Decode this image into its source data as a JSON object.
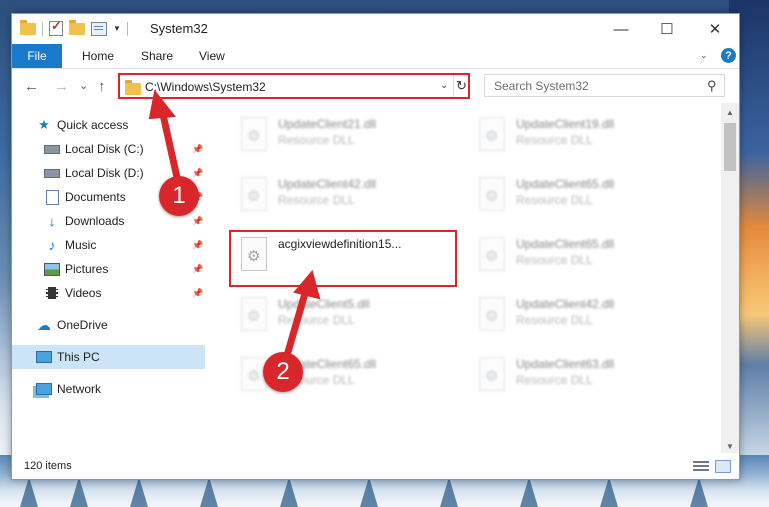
{
  "window": {
    "title": "System32"
  },
  "titlebar_controls": {
    "minimize": "—",
    "maximize": "☐",
    "close": "✕"
  },
  "ribbon": {
    "tabs": [
      "File",
      "Home",
      "Share",
      "View"
    ],
    "help_label": "?"
  },
  "navigation": {
    "back": "←",
    "forward": "→",
    "recent": "⌄",
    "up": "↑",
    "address_path": "C:\\Windows\\System32",
    "refresh": "↻"
  },
  "search": {
    "placeholder": "Search System32"
  },
  "sidebar": {
    "items": [
      {
        "label": "Quick access",
        "icon": "star-icon",
        "pinned": false
      },
      {
        "label": "Local Disk (C:)",
        "icon": "drive-icon",
        "pinned": true
      },
      {
        "label": "Local Disk (D:)",
        "icon": "drive-icon",
        "pinned": true
      },
      {
        "label": "Documents",
        "icon": "documents-icon",
        "pinned": true
      },
      {
        "label": "Downloads",
        "icon": "download-icon",
        "pinned": true
      },
      {
        "label": "Music",
        "icon": "music-icon",
        "pinned": true
      },
      {
        "label": "Pictures",
        "icon": "pictures-icon",
        "pinned": true
      },
      {
        "label": "Videos",
        "icon": "videos-icon",
        "pinned": true
      },
      {
        "label": "OneDrive",
        "icon": "cloud-icon",
        "pinned": false
      },
      {
        "label": "This PC",
        "icon": "computer-icon",
        "pinned": false,
        "selected": true
      },
      {
        "label": "Network",
        "icon": "network-icon",
        "pinned": false
      }
    ]
  },
  "files": [
    {
      "name": "UpdateClient21.dll",
      "type": "Resource DLL",
      "blurred": true
    },
    {
      "name": "UpdateClient19.dll",
      "type": "Resource DLL",
      "blurred": true
    },
    {
      "name": "UpdateClient42.dll",
      "type": "Resource DLL",
      "blurred": true
    },
    {
      "name": "UpdateClient65.dll",
      "type": "Resource DLL",
      "blurred": true
    },
    {
      "name": "acgixviewdefinition15...",
      "type": "",
      "blurred": false
    },
    {
      "name": "UpdateClient65.dll",
      "type": "Resource DLL",
      "blurred": true
    },
    {
      "name": "UpdateClient5.dll",
      "type": "Resource DLL",
      "blurred": true
    },
    {
      "name": "UpdateClient42.dll",
      "type": "Resource DLL",
      "blurred": true
    },
    {
      "name": "UpdateClient65.dll",
      "type": "Resource DLL",
      "blurred": true
    },
    {
      "name": "UpdateClient63.dll",
      "type": "Resource DLL",
      "blurred": true
    }
  ],
  "status": {
    "item_count": "120 items"
  },
  "annotations": {
    "step1": "1",
    "step2": "2",
    "color": "#d9262b"
  }
}
